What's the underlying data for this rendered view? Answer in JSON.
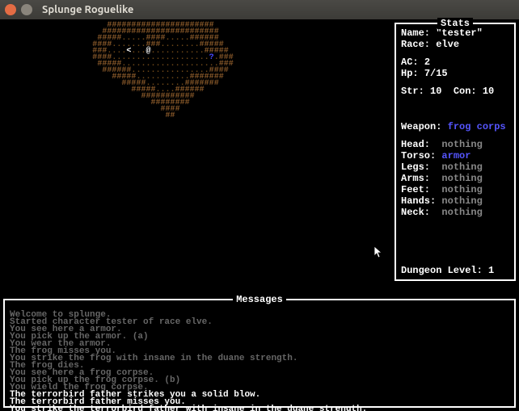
{
  "window": {
    "title": "Splunge Roguelike"
  },
  "stats": {
    "panel_title": "Stats",
    "name_label": "Name:",
    "name_value": "\"tester\"",
    "race_label": "Race:",
    "race_value": "elve",
    "ac_label": "AC:",
    "ac_value": "2",
    "hp_label": "Hp:",
    "hp_value": "7/15",
    "str_label": "Str:",
    "str_value": "10",
    "con_label": "Con:",
    "con_value": "10",
    "weapon_label": "Weapon:",
    "weapon_value": "frog corps",
    "equipment": [
      {
        "slot": "Head",
        "value": "nothing"
      },
      {
        "slot": "Torso",
        "value": "armor"
      },
      {
        "slot": "Legs",
        "value": "nothing"
      },
      {
        "slot": "Arms",
        "value": "nothing"
      },
      {
        "slot": "Feet",
        "value": "nothing"
      },
      {
        "slot": "Hands",
        "value": "nothing"
      },
      {
        "slot": "Neck",
        "value": "nothing"
      }
    ],
    "dungeon_label": "Dungeon Level:",
    "dungeon_value": "1"
  },
  "messages": {
    "panel_title": "Messages",
    "lines": [
      {
        "text": "",
        "age": "old"
      },
      {
        "text": "Welcome to splunge.",
        "age": "old"
      },
      {
        "text": "Started character tester of race elve.",
        "age": "old"
      },
      {
        "text": "You see here a armor.",
        "age": "old"
      },
      {
        "text": "You pick up the armor. (a)",
        "age": "old"
      },
      {
        "text": "You wear the armor.",
        "age": "old"
      },
      {
        "text": "The frog misses you.",
        "age": "old"
      },
      {
        "text": "You strike the frog with insane in the duane strength.",
        "age": "old"
      },
      {
        "text": "The frog dies.",
        "age": "old"
      },
      {
        "text": "You see here a frog corpse.",
        "age": "old"
      },
      {
        "text": "You pick up the frog corpse. (b)",
        "age": "old"
      },
      {
        "text": "You wield the frog corpse.",
        "age": "old"
      },
      {
        "text": "The terrorbird father strikes you a solid blow.",
        "age": "new"
      },
      {
        "text": "The terrorbird father misses you.",
        "age": "new"
      },
      {
        "text": "You strike the terrorbird father with insane in the duane strength.",
        "age": "new"
      }
    ]
  },
  "map": {
    "player_glyph": "@",
    "entity_glyph": "<",
    "item_glyph": "?",
    "rows": [
      "                      ~~#####~~~~~~~~####~~~           ",
      "                     ~########~~~~########~~~          ",
      "                    ~####.....~~~~.....#####~          ",
      "                   ~###.......~~~........####~         ",
      "                   ~##....<...@...........###~~        ",
      "                   ~###....................?.##~       ",
      "                    ~####....................##~       ",
      "                     ~~####................###~        ",
      "                       ~~###...........######~         ",
      "                         ~~###........####~~~          ",
      "                           ~~###....####~~             ",
      "                             ~~########~               ",
      "                               ~~####~~                ",
      "                                 ~##~                  ",
      "                                  ~~                   "
    ]
  }
}
